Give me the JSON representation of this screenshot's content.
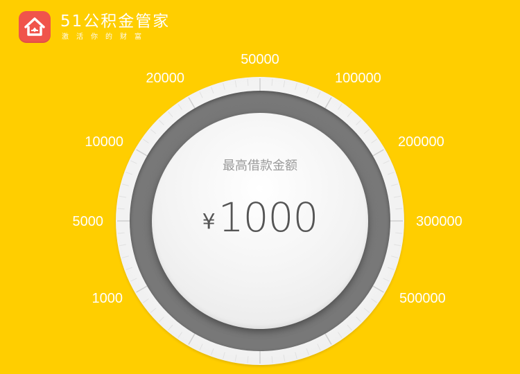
{
  "header": {
    "brand_name": "51公积金管家",
    "tagline": "激活你的财富",
    "logo_icon": "house-logo-icon",
    "logo_color": "#F0544B"
  },
  "dial": {
    "scale_labels": [
      "1000",
      "5000",
      "10000",
      "20000",
      "50000",
      "100000",
      "200000",
      "300000",
      "500000"
    ],
    "caption": "最高借款金额",
    "currency_symbol": "¥",
    "selected_amount": "1000"
  },
  "colors": {
    "background": "#FFCE00",
    "ring_dark": "#777777",
    "knob": "#F2F2F2",
    "text_gray": "#555555"
  }
}
